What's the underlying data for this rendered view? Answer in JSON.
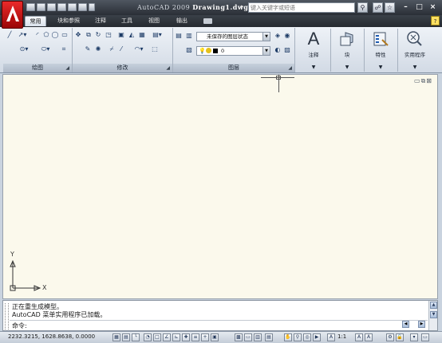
{
  "title": {
    "app_version": "AutoCAD 2009",
    "filename": "Drawing1.dwg"
  },
  "search": {
    "placeholder": "键入关键字或短语"
  },
  "ribbon_tabs": [
    "常用",
    "块和参照",
    "注释",
    "工具",
    "视图",
    "输出"
  ],
  "active_tab": "常用",
  "panels": {
    "draw": "绘图",
    "modify": "修改",
    "layers": "图层",
    "annotation": "注释",
    "block": "块",
    "properties": "特性",
    "utilities": "实用程序"
  },
  "layer_dropdown": {
    "value": "未保存的图层状态"
  },
  "layer_current": {
    "value": "0"
  },
  "ucs": {
    "x_label": "X",
    "y_label": "Y"
  },
  "command": {
    "history": [
      "正在重生成模型。",
      "AutoCAD 菜单实用程序已加载。"
    ],
    "prompt": "命令:"
  },
  "status": {
    "coordinates": "2232.3215, 1628.8638, 0.0000",
    "annotation_scale": "1:1"
  },
  "colors": {
    "accent_red": "#d81c1c",
    "drawing_background": "#fbf9ec",
    "titlebar": "#3a4048"
  },
  "help": {
    "label": "?"
  },
  "window_buttons": {
    "minimize": "–",
    "maximize": "□",
    "close": "×"
  }
}
